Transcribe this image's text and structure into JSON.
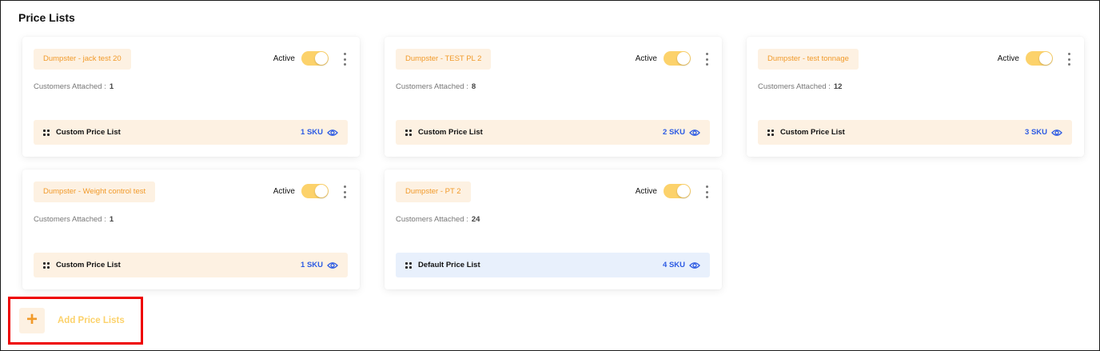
{
  "page": {
    "title": "Price Lists"
  },
  "labels": {
    "active": "Active",
    "customers_attached": "Customers Attached :"
  },
  "price_lists": [
    {
      "name": "Dumpster - jack test 20",
      "status": "Active",
      "customers": "1",
      "list_type": "Custom Price List",
      "sku": "1 SKU",
      "kind": "custom"
    },
    {
      "name": "Dumpster - TEST PL 2",
      "status": "Active",
      "customers": "8",
      "list_type": "Custom Price List",
      "sku": "2 SKU",
      "kind": "custom"
    },
    {
      "name": "Dumpster - test tonnage",
      "status": "Active",
      "customers": "12",
      "list_type": "Custom Price List",
      "sku": "3 SKU",
      "kind": "custom"
    },
    {
      "name": "Dumpster - Weight control test",
      "status": "Active",
      "customers": "1",
      "list_type": "Custom Price List",
      "sku": "1 SKU",
      "kind": "custom"
    },
    {
      "name": "Dumpster - PT 2",
      "status": "Active",
      "customers": "24",
      "list_type": "Default Price List",
      "sku": "4 SKU",
      "kind": "default"
    }
  ],
  "add_button": {
    "icon": "+",
    "label": "Add Price Lists"
  },
  "colors": {
    "accent_orange": "#f19a2a",
    "toggle_yellow": "#fcd26b",
    "sku_blue": "#2d5be3",
    "highlight_red": "#ee0000"
  }
}
